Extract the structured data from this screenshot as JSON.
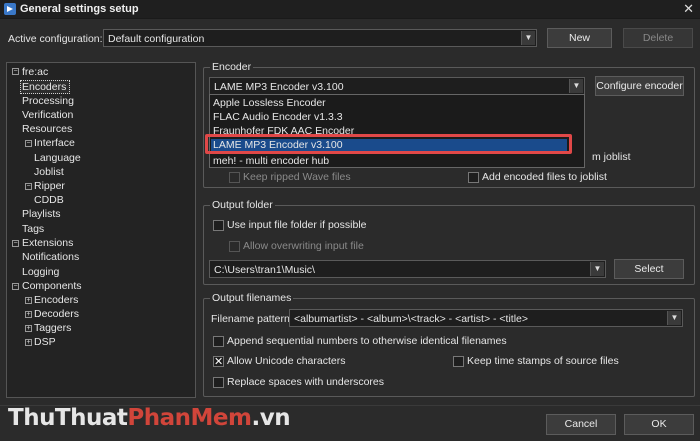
{
  "window": {
    "title": "General settings setup",
    "close_glyph": "✕"
  },
  "config": {
    "label": "Active configuration:",
    "value": "Default configuration",
    "new_label": "New",
    "delete_label": "Delete"
  },
  "tree": {
    "root": "fre:ac",
    "encoders": "Encoders",
    "processing": "Processing",
    "verification": "Verification",
    "resources": "Resources",
    "interface": "Interface",
    "language": "Language",
    "joblist": "Joblist",
    "ripper": "Ripper",
    "cddb": "CDDB",
    "playlists": "Playlists",
    "tags": "Tags",
    "extensions": "Extensions",
    "notifications": "Notifications",
    "logging": "Logging",
    "components": "Components",
    "comp_encoders": "Encoders",
    "comp_decoders": "Decoders",
    "comp_taggers": "Taggers",
    "comp_dsp": "DSP"
  },
  "encoder": {
    "group_title": "Encoder",
    "selected": "LAME MP3 Encoder v3.100",
    "configure_label": "Configure encoder",
    "options": [
      "Apple Lossless Encoder",
      "FLAC Audio Encoder v1.3.3",
      "Fraunhofer FDK AAC Encoder",
      "LAME MP3 Encoder v3.100",
      "meh! - multi encoder hub"
    ],
    "partial_joblist": "m joblist",
    "keep_ripped": "Keep ripped Wave files",
    "add_encoded": "Add encoded files to joblist"
  },
  "output_folder": {
    "group_title": "Output folder",
    "use_input": "Use input file folder if possible",
    "allow_overwrite": "Allow overwriting input file",
    "path": "C:\\Users\\tran1\\Music\\",
    "select_label": "Select"
  },
  "output_filenames": {
    "group_title": "Output filenames",
    "pattern_label": "Filename pattern:",
    "pattern": "<albumartist> - <album>\\<track> - <artist> - <title>",
    "append_sequential": "Append sequential numbers to otherwise identical filenames",
    "allow_unicode": "Allow Unicode characters",
    "keep_timestamps": "Keep time stamps of source files",
    "replace_spaces": "Replace spaces with underscores"
  },
  "footer": {
    "cancel_label": "Cancel",
    "ok_label": "OK"
  },
  "watermark": {
    "part1": "ThuThuat",
    "part2": "PhanMem",
    "part3": ".vn"
  }
}
